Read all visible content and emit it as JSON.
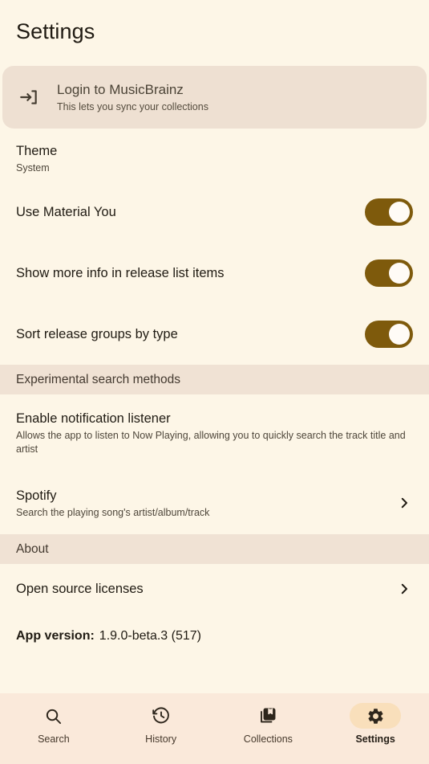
{
  "header": {
    "title": "Settings"
  },
  "colors": {
    "background": "#fdf6e7",
    "card": "#eee0d2",
    "section_header": "#f0e2d4",
    "toggle_on": "#7e5a0c",
    "nav_bar": "#fae9da",
    "nav_pill": "#f9dfbb",
    "text_primary": "#201b13"
  },
  "login_card": {
    "icon": "login-icon",
    "title": "Login to MusicBrainz",
    "subtitle": "This lets you sync your collections"
  },
  "settings": {
    "theme": {
      "title": "Theme",
      "value": "System"
    },
    "toggles": [
      {
        "title": "Use Material You",
        "on": true
      },
      {
        "title": "Show more info in release list items",
        "on": true
      },
      {
        "title": "Sort release groups by type",
        "on": true
      }
    ]
  },
  "sections": {
    "experimental": {
      "header": "Experimental search methods",
      "notification": {
        "title": "Enable notification listener",
        "subtitle": "Allows the app to listen to Now Playing, allowing you to quickly search the track title and artist"
      },
      "spotify": {
        "title": "Spotify",
        "subtitle": "Search the playing song's artist/album/track",
        "chevron": "chevron-right-icon"
      }
    },
    "about": {
      "header": "About",
      "licenses": {
        "title": "Open source licenses",
        "chevron": "chevron-right-icon"
      },
      "version": {
        "label": "App version:",
        "value": "1.9.0-beta.3 (517)"
      }
    }
  },
  "bottom_nav": {
    "items": [
      {
        "label": "Search",
        "icon": "search-icon",
        "active": false
      },
      {
        "label": "History",
        "icon": "history-icon",
        "active": false
      },
      {
        "label": "Collections",
        "icon": "collections-icon",
        "active": false
      },
      {
        "label": "Settings",
        "icon": "gear-icon",
        "active": true
      }
    ]
  }
}
